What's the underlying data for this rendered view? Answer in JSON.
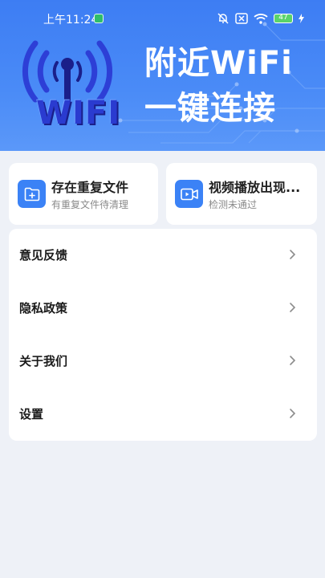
{
  "status_bar": {
    "time": "上午11:24",
    "battery": "47"
  },
  "hero": {
    "logo_text": "WIFI",
    "title_line1": "附近WiFi",
    "title_line2": "一键连接"
  },
  "cards": [
    {
      "title": "存在重复文件",
      "subtitle": "有重复文件待清理",
      "icon": "folder-plus-icon"
    },
    {
      "title": "视频播放出现...",
      "subtitle": "检测未通过",
      "icon": "video-icon"
    }
  ],
  "menu": {
    "items": [
      {
        "label": "意见反馈"
      },
      {
        "label": "隐私政策"
      },
      {
        "label": "关于我们"
      },
      {
        "label": "设置"
      }
    ]
  },
  "colors": {
    "hero_blue": "#3d7df3",
    "accent": "#3b82f6",
    "background": "#eef1f7"
  }
}
